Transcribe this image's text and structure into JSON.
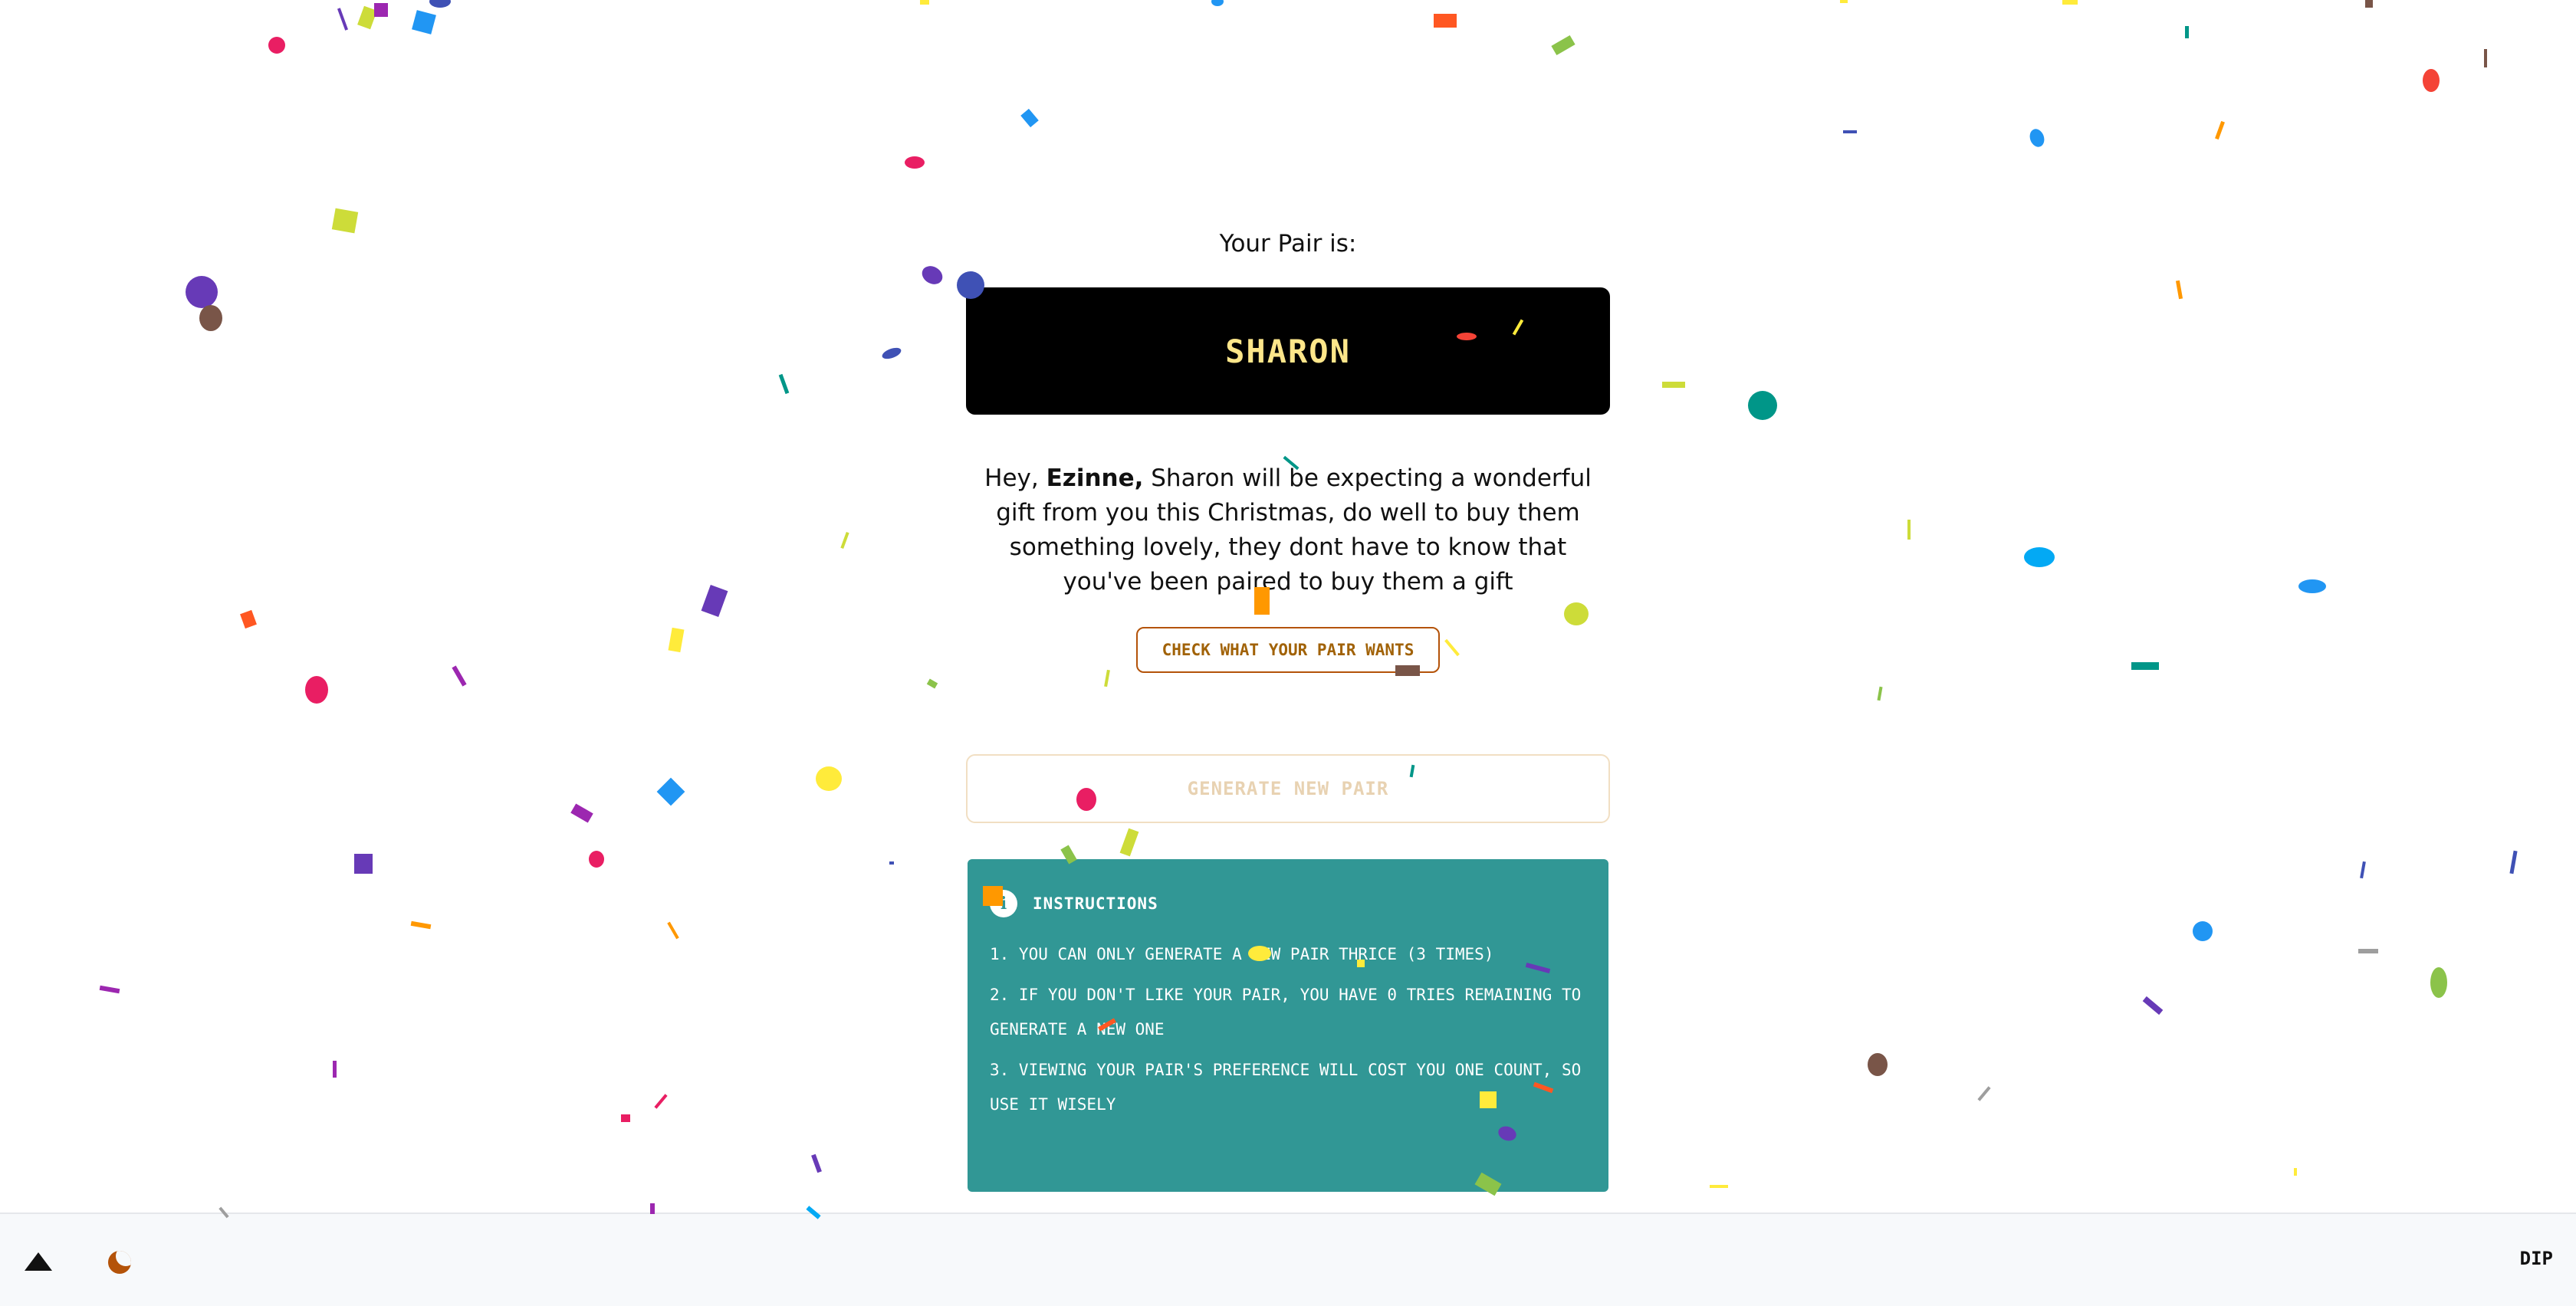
{
  "pair": {
    "heading": "Your Pair is:",
    "name": "SHARON"
  },
  "message": {
    "greeting": "Hey,",
    "user_name": "Ezinne,",
    "body": "Sharon will be expecting a wonderful gift from you this Christmas, do well to buy them something lovely, they dont have to know that you've been paired to buy them a gift"
  },
  "buttons": {
    "check_wants": "CHECK WHAT YOUR PAIR WANTS",
    "generate": "GENERATE NEW PAIR"
  },
  "instructions": {
    "icon_label": "i",
    "title": "INSTRUCTIONS",
    "items": [
      "1. YOU CAN ONLY GENERATE A NEW PAIR THRICE (3 TIMES)",
      "2. IF YOU DON'T LIKE YOUR PAIR, YOU HAVE 0 TRIES REMAINING TO GENERATE A NEW ONE",
      "3. VIEWING YOUR PAIR'S PREFERENCE WILL COST YOU ONE COUNT, SO USE IT WISELY"
    ]
  },
  "footer": {
    "scroll_top_icon": "triangle-up-icon",
    "theme_icon": "moon-icon",
    "brand": "DIP"
  },
  "colors": {
    "pair_box_bg": "#000000",
    "pair_name": "#fde68a",
    "accent_border": "#b45309",
    "instructions_bg": "#319795",
    "footer_bg": "#f7f9fb"
  }
}
